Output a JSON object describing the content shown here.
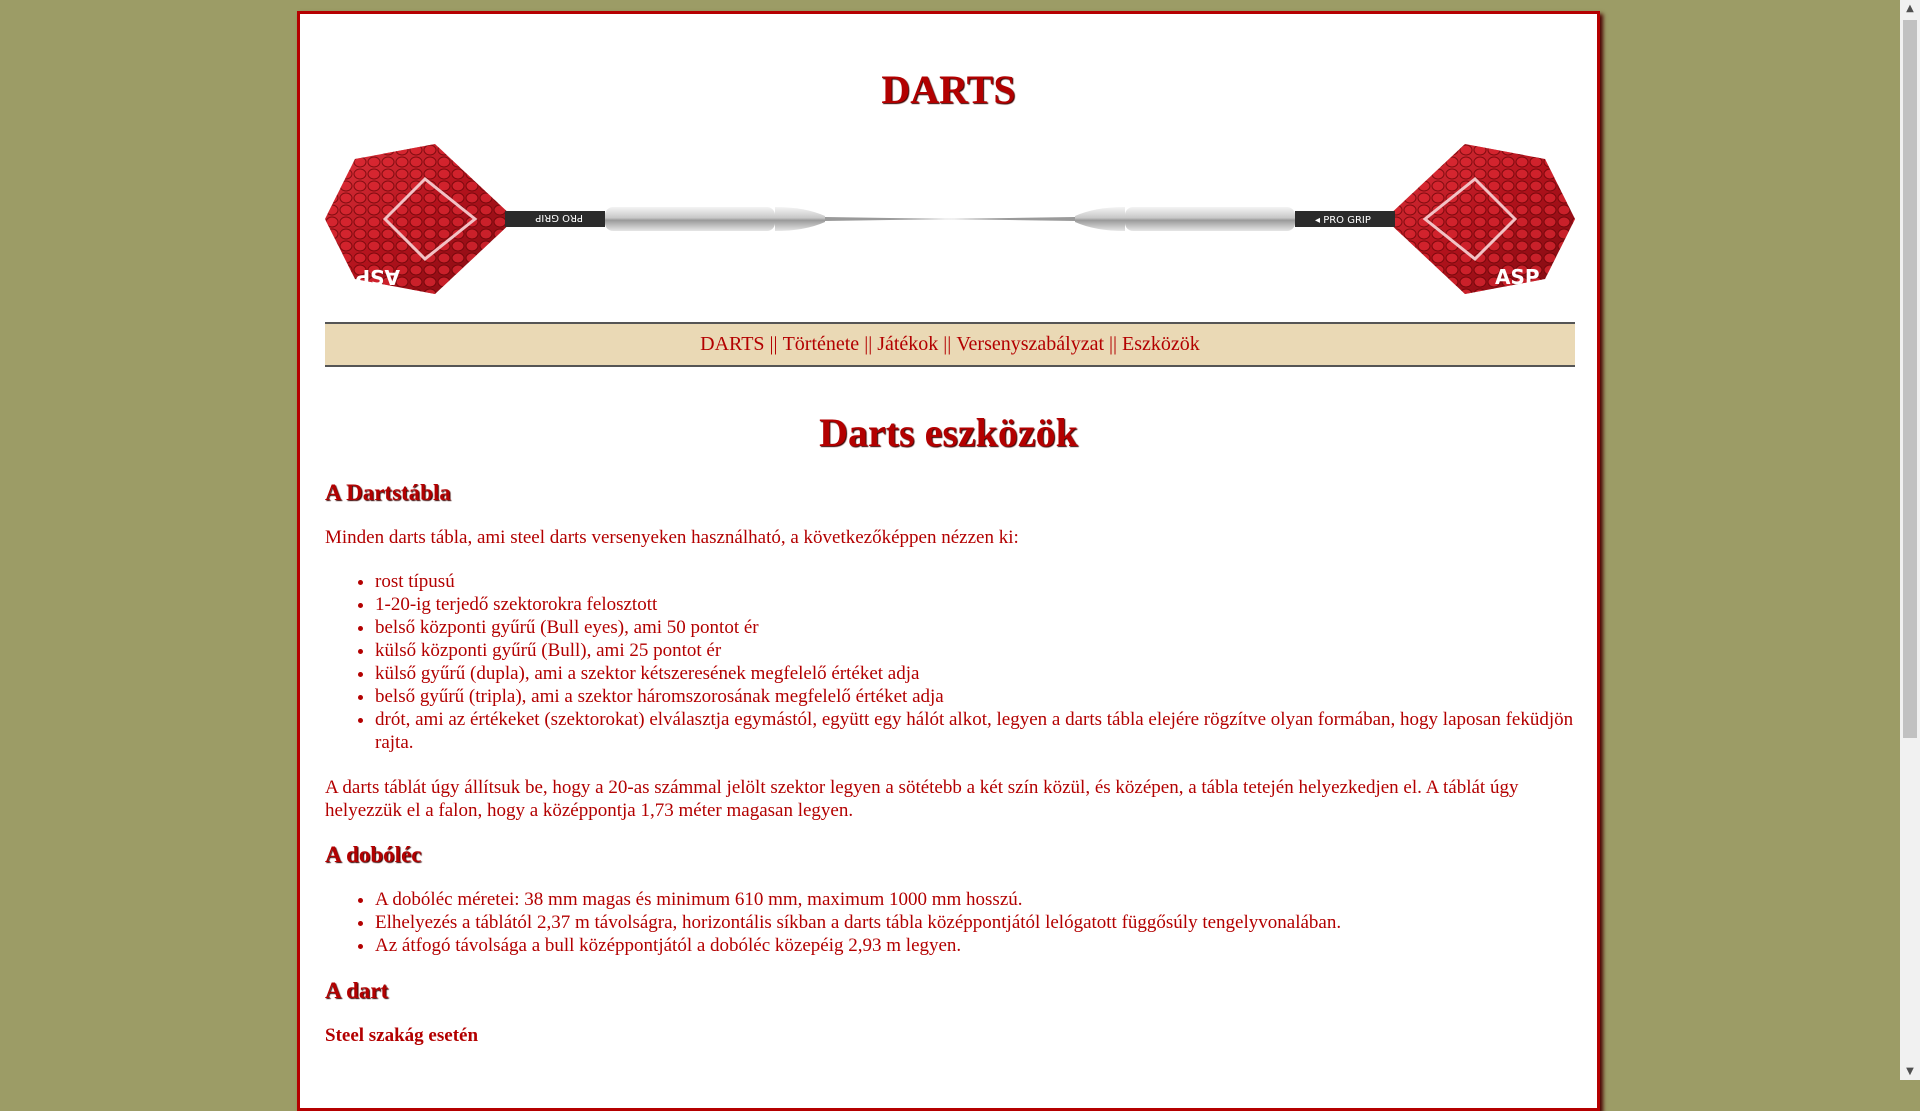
{
  "site": {
    "title": "DARTS"
  },
  "nav": {
    "items": [
      "DARTS",
      "Története",
      "Játékok",
      "Versenyszabályzat",
      "Eszközök"
    ],
    "separator": "||"
  },
  "page": {
    "heading": "Darts eszközök"
  },
  "sections": {
    "board": {
      "heading": "A Dartstábla",
      "intro": "Minden darts tábla, ami steel darts versenyeken használható, a következőképpen nézzen ki:",
      "items": [
        "rost típusú",
        "1-20-ig terjedő szektorokra felosztott",
        "belső központi gyűrű (Bull eyes), ami 50 pontot ér",
        "külső központi gyűrű (Bull), ami 25 pontot ér",
        "külső gyűrű (dupla), ami a szektor kétszeresének megfelelő értéket adja",
        "belső gyűrű (tripla), ami a szektor háromszorosának megfelelő értéket adja",
        "drót, ami az értékeket (szektorokat) elválasztja egymástól, együtt egy hálót alkot, legyen a darts tábla elejére rögzítve olyan formában, hogy laposan feküdjön rajta."
      ],
      "paragraph": "A darts táblát úgy állítsuk be, hogy a 20-as számmal jelölt szektor legyen a sötétebb a két szín közül, és középen, a tábla tetején helyezkedjen el. A táblát úgy helyezzük el a falon, hogy a középpontja 1,73 méter magasan legyen."
    },
    "oche": {
      "heading": "A dobóléc",
      "items": [
        "A dobóléc méretei: 38 mm magas és minimum 610 mm, maximum 1000 mm hosszú.",
        "Elhelyezés a táblától 2,37 m távolságra, horizontális síkban a darts tábla középpontjától lelógatott függősúly tengelyvonalában.",
        "Az átfogó távolsága a bull középpontjától a dobóléc közepéig 2,93 m legyen."
      ]
    },
    "dart": {
      "heading": "A dart",
      "subheading": "Steel szakág esetén"
    }
  },
  "banner": {
    "left_brand": "PRO GRIP",
    "right_brand": "PRO GRIP",
    "left_logo": "ASP",
    "right_logo": "ASP"
  },
  "scrollbar": {
    "position": 0.0,
    "icons": [
      "chevron-up-icon",
      "chevron-down-icon"
    ]
  }
}
